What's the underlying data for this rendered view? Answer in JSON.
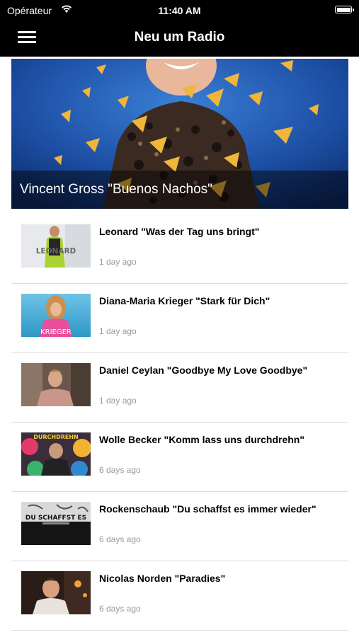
{
  "status": {
    "carrier": "Opérateur",
    "time": "11:40 AM",
    "battery_level": 1.0,
    "icons": [
      "wifi-icon",
      "battery-icon"
    ]
  },
  "navbar": {
    "title": "Neu um Radio",
    "menu_icon": "hamburger-menu-icon"
  },
  "hero": {
    "title": "Vincent Gross \"Buenos Nachos\""
  },
  "articles": [
    {
      "title": "Leonard \"Was der Tag uns bringt\"",
      "time": "1 day ago",
      "thumb_text": "LEONARD"
    },
    {
      "title": "Diana-Maria Krieger \"Stark für Dich\"",
      "time": "1 day ago",
      "thumb_text": "KRIEGER"
    },
    {
      "title": "Daniel Ceylan \"Goodbye My Love Goodbye\"",
      "time": "1 day ago",
      "thumb_text": ""
    },
    {
      "title": "Wolle Becker \"Komm lass uns durchdrehn\"",
      "time": "6 days ago",
      "thumb_text": "DURCHDREHN"
    },
    {
      "title": "Rockenschaub \"Du schaffst es immer wieder\"",
      "time": "6 days ago",
      "thumb_text": "DU SCHAFFST ES"
    },
    {
      "title": "Nicolas Norden \"Paradies\"",
      "time": "6 days ago",
      "thumb_text": ""
    }
  ],
  "colors": {
    "navbar": "#000000",
    "background": "#ffffff",
    "hero_blue": "#1f4f9e",
    "chip_yellow": "#f0b63a",
    "meta_gray": "#9a9a9a",
    "divider": "#dcdcdc"
  }
}
